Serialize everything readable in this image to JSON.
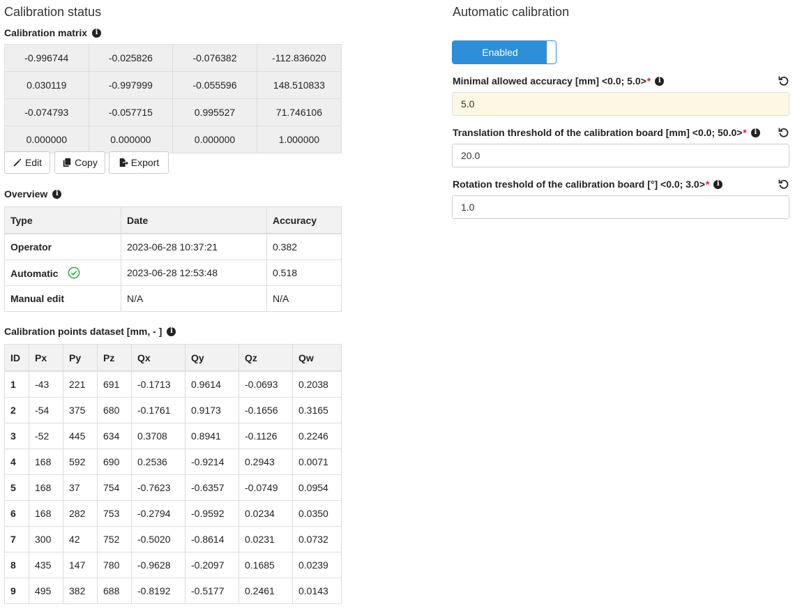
{
  "left": {
    "title": "Calibration status",
    "matrix": {
      "label": "Calibration matrix",
      "rows": [
        [
          "-0.996744",
          "-0.025826",
          "-0.076382",
          "-112.836020"
        ],
        [
          "0.030119",
          "-0.997999",
          "-0.055596",
          "148.510833"
        ],
        [
          "-0.074793",
          "-0.057715",
          "0.995527",
          "71.746106"
        ],
        [
          "0.000000",
          "0.000000",
          "0.000000",
          "1.000000"
        ]
      ],
      "buttons": {
        "edit": "Edit",
        "copy": "Copy",
        "export": "Export"
      }
    },
    "overview": {
      "label": "Overview",
      "headers": [
        "Type",
        "Date",
        "Accuracy"
      ],
      "rows": [
        [
          "Operator",
          "2023-06-28 10:37:21",
          "0.382"
        ],
        [
          "Automatic",
          "2023-06-28 12:53:48",
          "0.518"
        ],
        [
          "Manual edit",
          "N/A",
          "N/A"
        ]
      ]
    },
    "dataset": {
      "label": "Calibration points dataset [mm, - ]",
      "headers": [
        "ID",
        "Px",
        "Py",
        "Pz",
        "Qx",
        "Qy",
        "Qz",
        "Qw"
      ],
      "rows": [
        [
          "1",
          "-43",
          "221",
          "691",
          "-0.1713",
          "0.9614",
          "-0.0693",
          "0.2038"
        ],
        [
          "2",
          "-54",
          "375",
          "680",
          "-0.1761",
          "0.9173",
          "-0.1656",
          "0.3165"
        ],
        [
          "3",
          "-52",
          "445",
          "634",
          "0.3708",
          "0.8941",
          "-0.1126",
          "0.2246"
        ],
        [
          "4",
          "168",
          "592",
          "690",
          "0.2536",
          "-0.9214",
          "0.2943",
          "0.0071"
        ],
        [
          "5",
          "168",
          "37",
          "754",
          "-0.7623",
          "-0.6357",
          "-0.0749",
          "0.0954"
        ],
        [
          "6",
          "168",
          "282",
          "753",
          "-0.2794",
          "-0.9592",
          "0.0234",
          "0.0350"
        ],
        [
          "7",
          "300",
          "42",
          "752",
          "-0.5020",
          "-0.8614",
          "0.0231",
          "0.0732"
        ],
        [
          "8",
          "435",
          "147",
          "780",
          "-0.9628",
          "-0.2097",
          "0.1685",
          "0.0239"
        ],
        [
          "9",
          "495",
          "382",
          "688",
          "-0.8192",
          "-0.5177",
          "0.2461",
          "0.0143"
        ]
      ]
    }
  },
  "right": {
    "title": "Automatic calibration",
    "toggle_label": "Enabled",
    "fields": [
      {
        "label": "Minimal allowed accuracy [mm] <0.0; 5.0>",
        "value": "5.0"
      },
      {
        "label": "Translation threshold of the calibration board [mm] <0.0; 50.0>",
        "value": "20.0"
      },
      {
        "label": "Rotation treshold of the calibration board [°] <0.0; 3.0>",
        "value": "1.0"
      }
    ],
    "required_mark": "*"
  },
  "colors": {
    "accent": "#2e8fd8",
    "success": "#28a745",
    "required": "#e02020",
    "warning_bg": "#fcf8e3"
  }
}
